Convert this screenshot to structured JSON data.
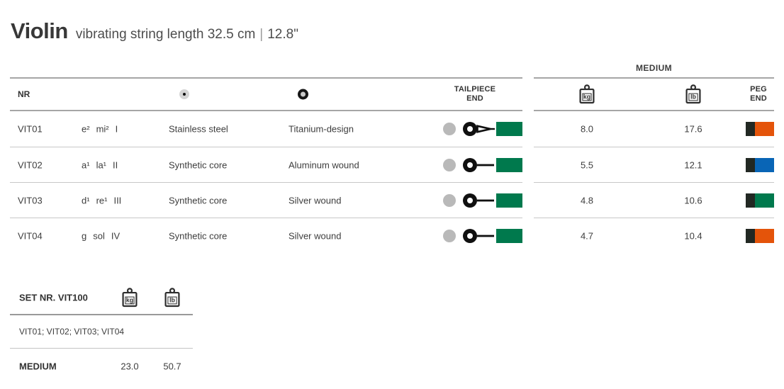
{
  "header": {
    "title": "Violin",
    "subtitle": "vibrating string length 32.5 cm",
    "separator": "|",
    "length_inches": "12.8\""
  },
  "icons": {
    "kg": "kg",
    "lb": "lb"
  },
  "strings_table": {
    "nr_header": "NR",
    "tailpiece_header": [
      "TAILPIECE",
      "END"
    ],
    "peg_header": [
      "PEG",
      "END"
    ],
    "gauge_header": "MEDIUM",
    "rows": [
      {
        "nr": "VIT01",
        "pitch": "e²",
        "solfege": "mi²",
        "numeral": "I",
        "core": "Stainless steel",
        "winding": "Titanium-design",
        "tailpiece_type": "loop-end",
        "tailpiece_color": "#00794d",
        "kg": "8.0",
        "lb": "17.6",
        "peg_black": "#222823",
        "peg_color": "#e4540a"
      },
      {
        "nr": "VIT02",
        "pitch": "a¹",
        "solfege": "la¹",
        "numeral": "II",
        "core": "Synthetic core",
        "winding": "Aluminum wound",
        "tailpiece_type": "ball-end",
        "tailpiece_color": "#00794d",
        "kg": "5.5",
        "lb": "12.1",
        "peg_black": "#222823",
        "peg_color": "#0965b6"
      },
      {
        "nr": "VIT03",
        "pitch": "d¹",
        "solfege": "re¹",
        "numeral": "III",
        "core": "Synthetic core",
        "winding": "Silver wound",
        "tailpiece_type": "ball-end",
        "tailpiece_color": "#00794d",
        "kg": "4.8",
        "lb": "10.6",
        "peg_black": "#222823",
        "peg_color": "#00794d"
      },
      {
        "nr": "VIT04",
        "pitch": "g",
        "solfege": "sol",
        "numeral": "IV",
        "core": "Synthetic core",
        "winding": "Silver wound",
        "tailpiece_type": "ball-end",
        "tailpiece_color": "#00794d",
        "kg": "4.7",
        "lb": "10.4",
        "peg_black": "#222823",
        "peg_color": "#e4540a"
      }
    ]
  },
  "set_table": {
    "title": "SET NR. VIT100",
    "contents": "VIT01; VIT02; VIT03; VIT04",
    "gauge": "MEDIUM",
    "kg": "23.0",
    "lb": "50.7"
  },
  "colors": {
    "green": "#00794d",
    "orange": "#e4540a",
    "blue": "#0965b6",
    "charcoal": "#222823",
    "gray_dot": "#b9b9b9"
  }
}
